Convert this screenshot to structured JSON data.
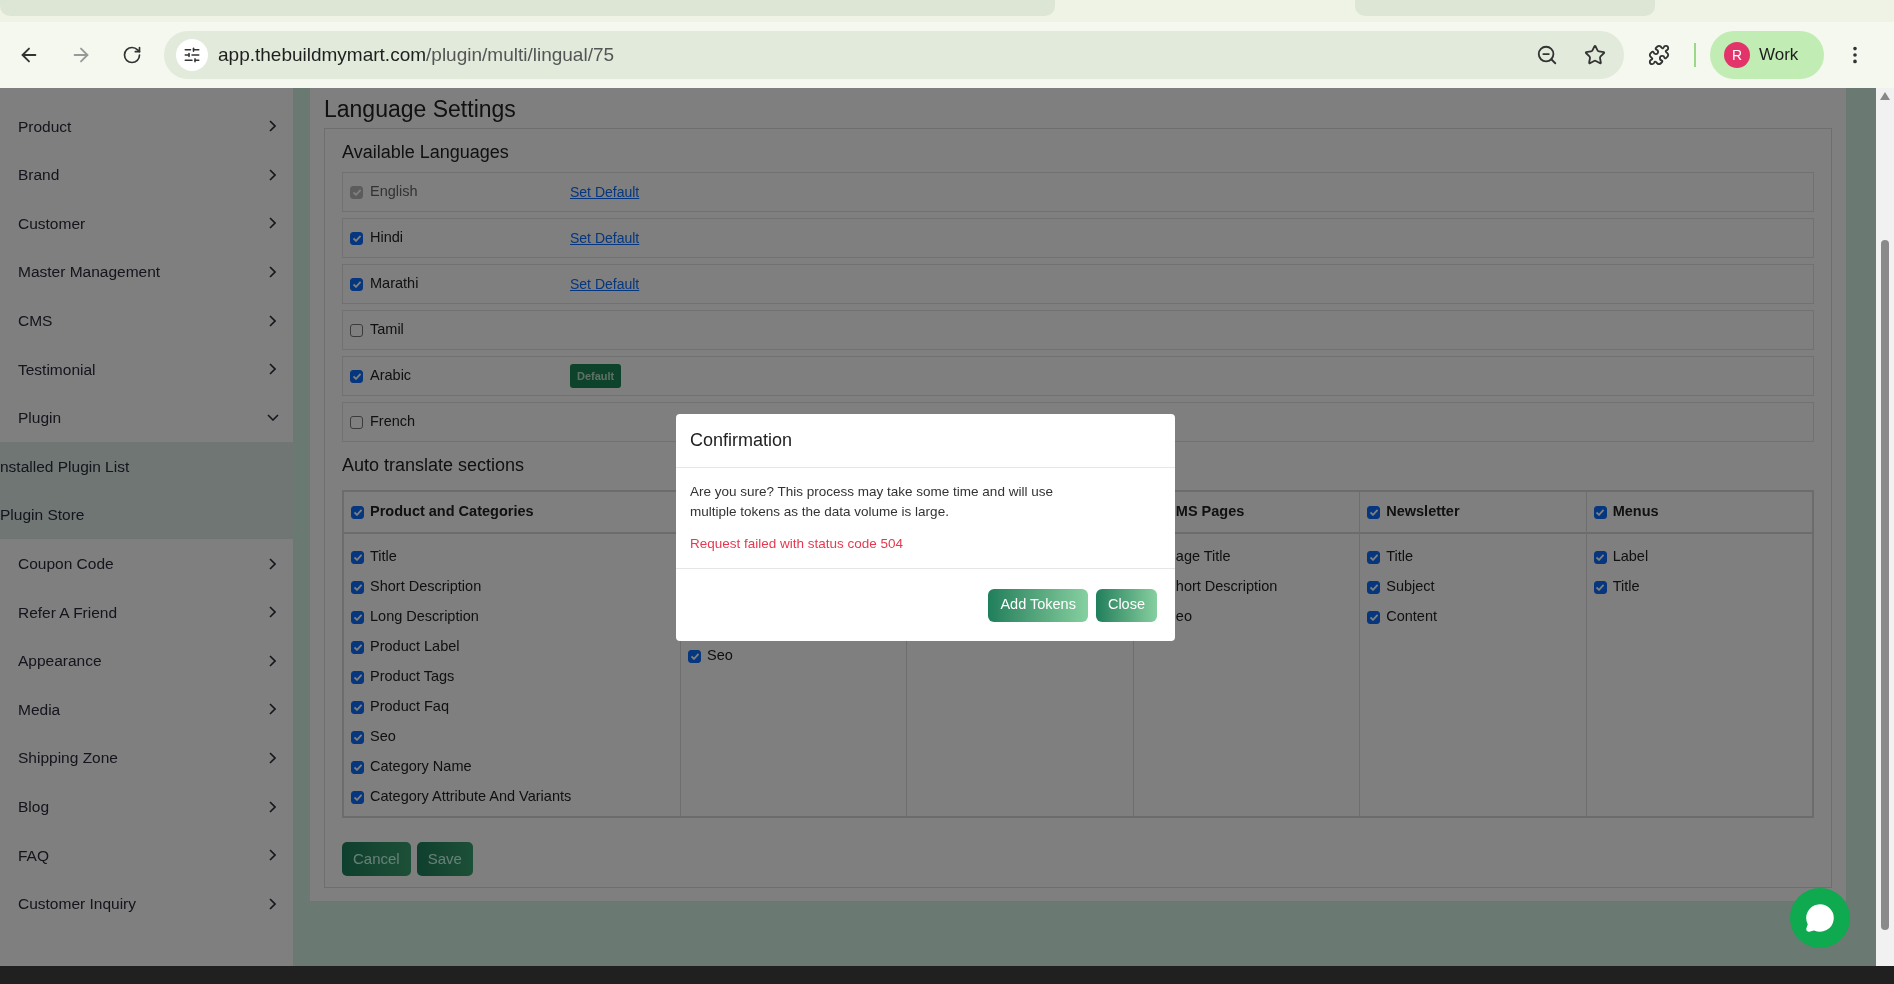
{
  "browser": {
    "url_host": "app.thebuildmymart.com",
    "url_path": "/plugin/multi/lingual/75",
    "profile_initial": "R",
    "profile_label": "Work"
  },
  "sidebar": {
    "items": [
      {
        "label": "Product",
        "expanded": false
      },
      {
        "label": "Brand",
        "expanded": false
      },
      {
        "label": "Customer",
        "expanded": false
      },
      {
        "label": "Master Management",
        "expanded": false
      },
      {
        "label": "CMS",
        "expanded": false
      },
      {
        "label": "Testimonial",
        "expanded": false
      },
      {
        "label": "Plugin",
        "expanded": true,
        "children": [
          {
            "label": "nstalled Plugin List"
          },
          {
            "label": "Plugin Store"
          }
        ]
      },
      {
        "label": "Coupon Code",
        "expanded": false
      },
      {
        "label": "Refer A Friend",
        "expanded": false
      },
      {
        "label": "Appearance",
        "expanded": false
      },
      {
        "label": "Media",
        "expanded": false
      },
      {
        "label": "Shipping Zone",
        "expanded": false
      },
      {
        "label": "Blog",
        "expanded": false
      },
      {
        "label": "FAQ",
        "expanded": false
      },
      {
        "label": "Customer Inquiry",
        "expanded": false
      }
    ]
  },
  "page": {
    "title": "Language Settings",
    "languages_heading": "Available Languages",
    "languages": [
      {
        "name": "English",
        "checked": true,
        "disabled": true,
        "action": {
          "kind": "link",
          "label": "Set Default"
        }
      },
      {
        "name": "Hindi",
        "checked": true,
        "disabled": false,
        "action": {
          "kind": "link",
          "label": "Set Default"
        }
      },
      {
        "name": "Marathi",
        "checked": true,
        "disabled": false,
        "action": {
          "kind": "link",
          "label": "Set Default"
        }
      },
      {
        "name": "Tamil",
        "checked": false,
        "disabled": false
      },
      {
        "name": "Arabic",
        "checked": true,
        "disabled": false,
        "action": {
          "kind": "badge",
          "label": "Default"
        }
      },
      {
        "name": "French",
        "checked": false,
        "disabled": false
      }
    ],
    "translate_heading": "Auto translate sections",
    "sections": [
      {
        "kind": "full",
        "title": "Product and Categories",
        "checked": true,
        "items": [
          {
            "label": "Title",
            "checked": true
          },
          {
            "label": "Short Description",
            "checked": true
          },
          {
            "label": "Long Description",
            "checked": true
          },
          {
            "label": "Product Label",
            "checked": true
          },
          {
            "label": "Product Tags",
            "checked": true
          },
          {
            "label": "Product Faq",
            "checked": true
          },
          {
            "label": "Seo",
            "checked": true
          },
          {
            "label": "Category Name",
            "checked": true
          },
          {
            "label": "Category Attribute And Variants",
            "checked": true
          }
        ]
      },
      {
        "kind": "covered",
        "items": [
          {
            "label": "Seo",
            "checked": true
          }
        ]
      },
      {
        "kind": "covered"
      },
      {
        "kind": "clipped",
        "title": "MS Pages",
        "items": [
          {
            "label": "age Title"
          },
          {
            "label": "hort Description"
          },
          {
            "label": "eo"
          }
        ]
      },
      {
        "kind": "full",
        "title": "Newsletter",
        "checked": true,
        "items": [
          {
            "label": "Title",
            "checked": true
          },
          {
            "label": "Subject",
            "checked": true
          },
          {
            "label": "Content",
            "checked": true
          }
        ]
      },
      {
        "kind": "full",
        "title": "Menus",
        "checked": true,
        "items": [
          {
            "label": "Label",
            "checked": true
          },
          {
            "label": "Title",
            "checked": true
          }
        ]
      }
    ],
    "buttons": [
      {
        "label": "Cancel"
      },
      {
        "label": "Save"
      }
    ]
  },
  "dialog": {
    "title": "Confirmation",
    "message": "Are you sure? This process may take some time and will use multiple tokens as the data volume is large.",
    "error": "Request failed with status code 504",
    "buttons": [
      {
        "label": "Add Tokens"
      },
      {
        "label": "Close"
      }
    ]
  }
}
